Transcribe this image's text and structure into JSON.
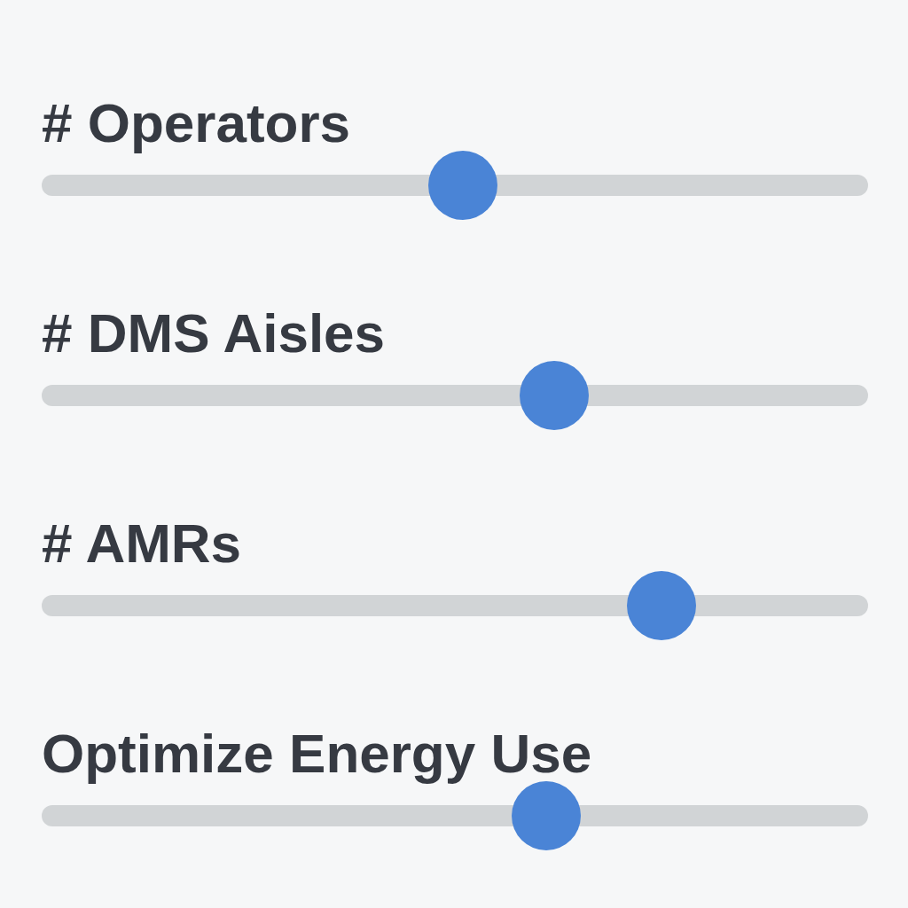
{
  "sliders": [
    {
      "label": "# Operators",
      "level": 0.51
    },
    {
      "label": "# DMS Aisles",
      "level": 0.62
    },
    {
      "label": "# AMRs",
      "level": 0.75
    },
    {
      "label": "Optimize Energy Use",
      "level": 0.61
    }
  ]
}
